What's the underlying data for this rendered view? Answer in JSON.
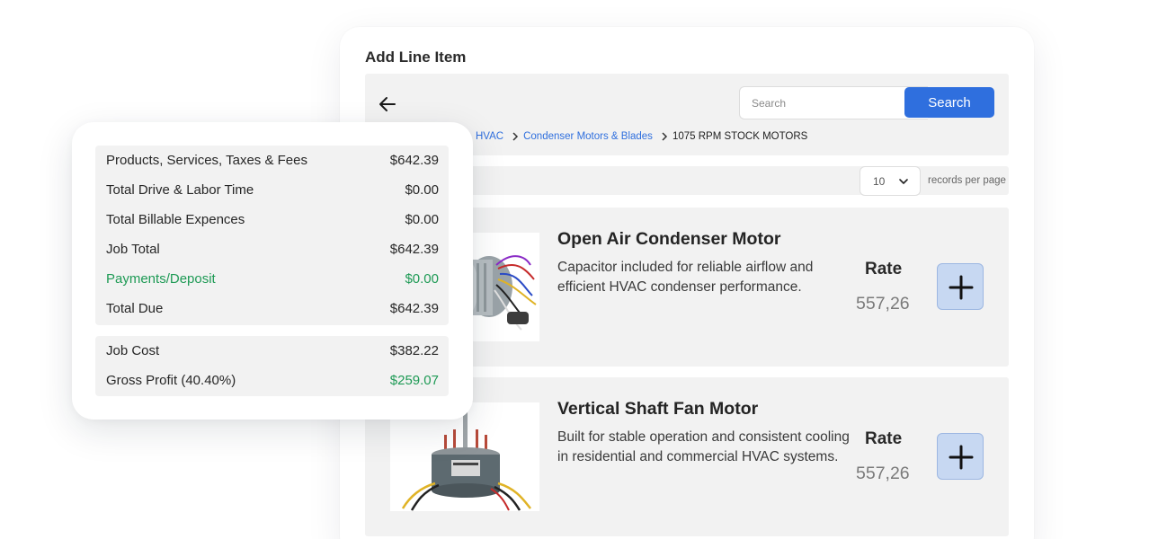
{
  "dialog": {
    "title": "Add Line Item",
    "search": {
      "placeholder": "Search",
      "button_label": "Search"
    },
    "breadcrumbs": [
      {
        "label": "HVAC",
        "link": true
      },
      {
        "label": "Condenser Motors & Blades",
        "link": true
      },
      {
        "label": "1075 RPM STOCK MOTORS",
        "link": false
      }
    ],
    "pagination": {
      "per_page_value": "10",
      "per_page_label": "records per page"
    },
    "products": [
      {
        "name": "Open Air Condenser Motor",
        "description": "Capacitor included for reliable airflow and efficient HVAC condenser performance.",
        "rate_label": "Rate",
        "rate_value": "557,26"
      },
      {
        "name": "Vertical Shaft Fan Motor",
        "description": "Built for stable operation and consistent cooling in residential and commercial HVAC systems.",
        "rate_label": "Rate",
        "rate_value": "557,26"
      }
    ]
  },
  "summary": {
    "totals": [
      {
        "label": "Products, Services, Taxes & Fees",
        "value": "$642.39",
        "highlight": false
      },
      {
        "label": "Total Drive & Labor Time",
        "value": "$0.00",
        "highlight": false
      },
      {
        "label": "Total Billable Expences",
        "value": "$0.00",
        "highlight": false
      },
      {
        "label": "Job Total",
        "value": "$642.39",
        "highlight": false
      },
      {
        "label": "Payments/Deposit",
        "value": "$0.00",
        "highlight": true
      },
      {
        "label": "Total Due",
        "value": "$642.39",
        "highlight": false
      }
    ],
    "profit": [
      {
        "label": "Job Cost",
        "value": "$382.22",
        "value_highlight": false
      },
      {
        "label": "Gross Profit (40.40%)",
        "value": "$259.07",
        "value_highlight": true
      }
    ]
  },
  "colors": {
    "accent": "#2f6fde",
    "positive": "#1e9a55",
    "panel_bg": "#f2f2f2",
    "add_button_bg": "#c7d8f2"
  },
  "icons": {
    "back": "arrow-left-icon",
    "breadcrumb_separator": "chevron-right-icon",
    "per_page": "chevron-down-icon",
    "add": "plus-icon"
  }
}
